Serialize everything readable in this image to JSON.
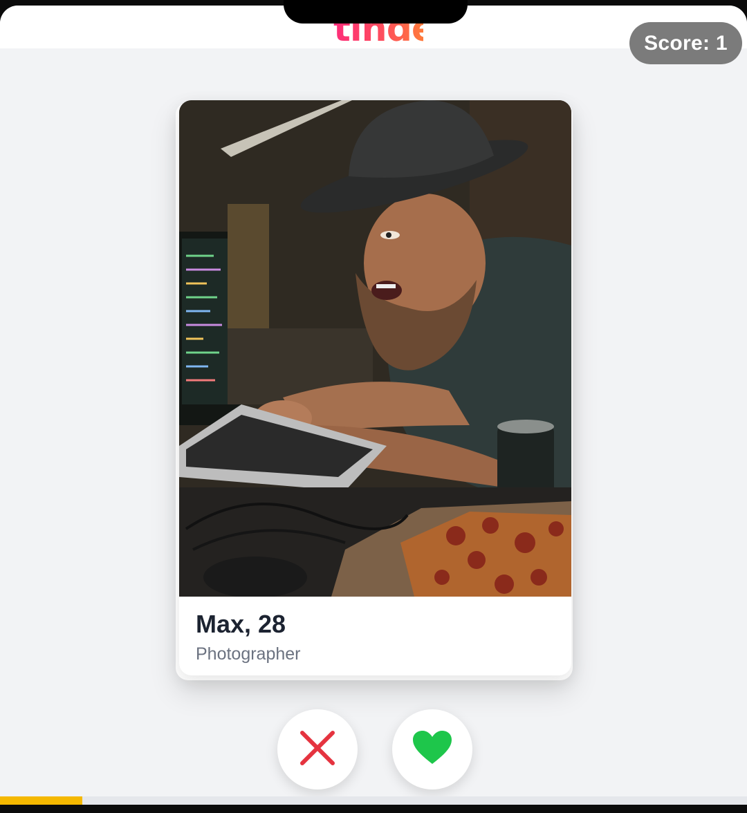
{
  "app": {
    "logo_text": "tinder"
  },
  "header": {
    "score_label": "Score: 1"
  },
  "profile": {
    "name_age": "Max, 28",
    "occupation": "Photographer"
  },
  "actions": {
    "nope_icon": "close-icon",
    "like_icon": "heart-icon",
    "nope_color": "#e5333f",
    "like_color": "#1ec64b"
  },
  "progress": {
    "fraction": 0.11,
    "color": "#f5b800"
  }
}
